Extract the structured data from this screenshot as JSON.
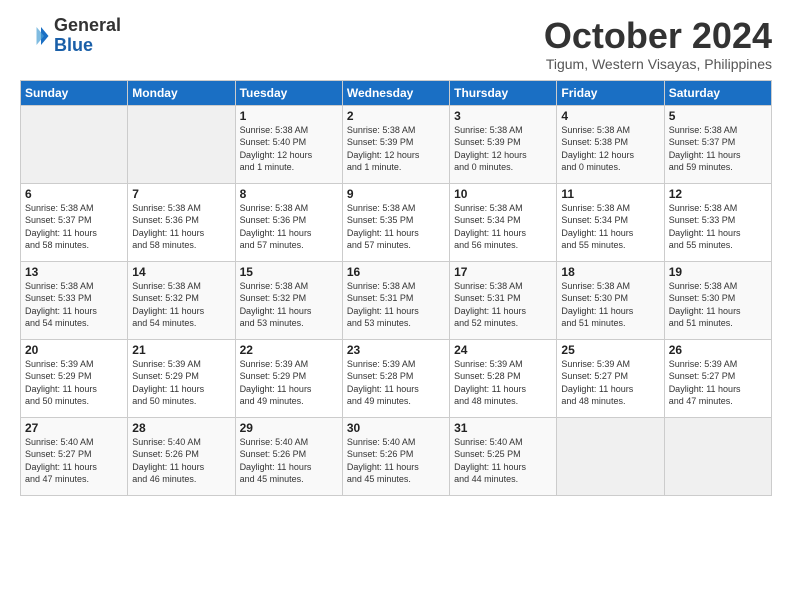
{
  "logo": {
    "line1": "General",
    "line2": "Blue"
  },
  "title": "October 2024",
  "location": "Tigum, Western Visayas, Philippines",
  "days_header": [
    "Sunday",
    "Monday",
    "Tuesday",
    "Wednesday",
    "Thursday",
    "Friday",
    "Saturday"
  ],
  "weeks": [
    [
      {
        "num": "",
        "info": ""
      },
      {
        "num": "",
        "info": ""
      },
      {
        "num": "1",
        "info": "Sunrise: 5:38 AM\nSunset: 5:40 PM\nDaylight: 12 hours\nand 1 minute."
      },
      {
        "num": "2",
        "info": "Sunrise: 5:38 AM\nSunset: 5:39 PM\nDaylight: 12 hours\nand 1 minute."
      },
      {
        "num": "3",
        "info": "Sunrise: 5:38 AM\nSunset: 5:39 PM\nDaylight: 12 hours\nand 0 minutes."
      },
      {
        "num": "4",
        "info": "Sunrise: 5:38 AM\nSunset: 5:38 PM\nDaylight: 12 hours\nand 0 minutes."
      },
      {
        "num": "5",
        "info": "Sunrise: 5:38 AM\nSunset: 5:37 PM\nDaylight: 11 hours\nand 59 minutes."
      }
    ],
    [
      {
        "num": "6",
        "info": "Sunrise: 5:38 AM\nSunset: 5:37 PM\nDaylight: 11 hours\nand 58 minutes."
      },
      {
        "num": "7",
        "info": "Sunrise: 5:38 AM\nSunset: 5:36 PM\nDaylight: 11 hours\nand 58 minutes."
      },
      {
        "num": "8",
        "info": "Sunrise: 5:38 AM\nSunset: 5:36 PM\nDaylight: 11 hours\nand 57 minutes."
      },
      {
        "num": "9",
        "info": "Sunrise: 5:38 AM\nSunset: 5:35 PM\nDaylight: 11 hours\nand 57 minutes."
      },
      {
        "num": "10",
        "info": "Sunrise: 5:38 AM\nSunset: 5:34 PM\nDaylight: 11 hours\nand 56 minutes."
      },
      {
        "num": "11",
        "info": "Sunrise: 5:38 AM\nSunset: 5:34 PM\nDaylight: 11 hours\nand 55 minutes."
      },
      {
        "num": "12",
        "info": "Sunrise: 5:38 AM\nSunset: 5:33 PM\nDaylight: 11 hours\nand 55 minutes."
      }
    ],
    [
      {
        "num": "13",
        "info": "Sunrise: 5:38 AM\nSunset: 5:33 PM\nDaylight: 11 hours\nand 54 minutes."
      },
      {
        "num": "14",
        "info": "Sunrise: 5:38 AM\nSunset: 5:32 PM\nDaylight: 11 hours\nand 54 minutes."
      },
      {
        "num": "15",
        "info": "Sunrise: 5:38 AM\nSunset: 5:32 PM\nDaylight: 11 hours\nand 53 minutes."
      },
      {
        "num": "16",
        "info": "Sunrise: 5:38 AM\nSunset: 5:31 PM\nDaylight: 11 hours\nand 53 minutes."
      },
      {
        "num": "17",
        "info": "Sunrise: 5:38 AM\nSunset: 5:31 PM\nDaylight: 11 hours\nand 52 minutes."
      },
      {
        "num": "18",
        "info": "Sunrise: 5:38 AM\nSunset: 5:30 PM\nDaylight: 11 hours\nand 51 minutes."
      },
      {
        "num": "19",
        "info": "Sunrise: 5:38 AM\nSunset: 5:30 PM\nDaylight: 11 hours\nand 51 minutes."
      }
    ],
    [
      {
        "num": "20",
        "info": "Sunrise: 5:39 AM\nSunset: 5:29 PM\nDaylight: 11 hours\nand 50 minutes."
      },
      {
        "num": "21",
        "info": "Sunrise: 5:39 AM\nSunset: 5:29 PM\nDaylight: 11 hours\nand 50 minutes."
      },
      {
        "num": "22",
        "info": "Sunrise: 5:39 AM\nSunset: 5:29 PM\nDaylight: 11 hours\nand 49 minutes."
      },
      {
        "num": "23",
        "info": "Sunrise: 5:39 AM\nSunset: 5:28 PM\nDaylight: 11 hours\nand 49 minutes."
      },
      {
        "num": "24",
        "info": "Sunrise: 5:39 AM\nSunset: 5:28 PM\nDaylight: 11 hours\nand 48 minutes."
      },
      {
        "num": "25",
        "info": "Sunrise: 5:39 AM\nSunset: 5:27 PM\nDaylight: 11 hours\nand 48 minutes."
      },
      {
        "num": "26",
        "info": "Sunrise: 5:39 AM\nSunset: 5:27 PM\nDaylight: 11 hours\nand 47 minutes."
      }
    ],
    [
      {
        "num": "27",
        "info": "Sunrise: 5:40 AM\nSunset: 5:27 PM\nDaylight: 11 hours\nand 47 minutes."
      },
      {
        "num": "28",
        "info": "Sunrise: 5:40 AM\nSunset: 5:26 PM\nDaylight: 11 hours\nand 46 minutes."
      },
      {
        "num": "29",
        "info": "Sunrise: 5:40 AM\nSunset: 5:26 PM\nDaylight: 11 hours\nand 45 minutes."
      },
      {
        "num": "30",
        "info": "Sunrise: 5:40 AM\nSunset: 5:26 PM\nDaylight: 11 hours\nand 45 minutes."
      },
      {
        "num": "31",
        "info": "Sunrise: 5:40 AM\nSunset: 5:25 PM\nDaylight: 11 hours\nand 44 minutes."
      },
      {
        "num": "",
        "info": ""
      },
      {
        "num": "",
        "info": ""
      }
    ]
  ]
}
